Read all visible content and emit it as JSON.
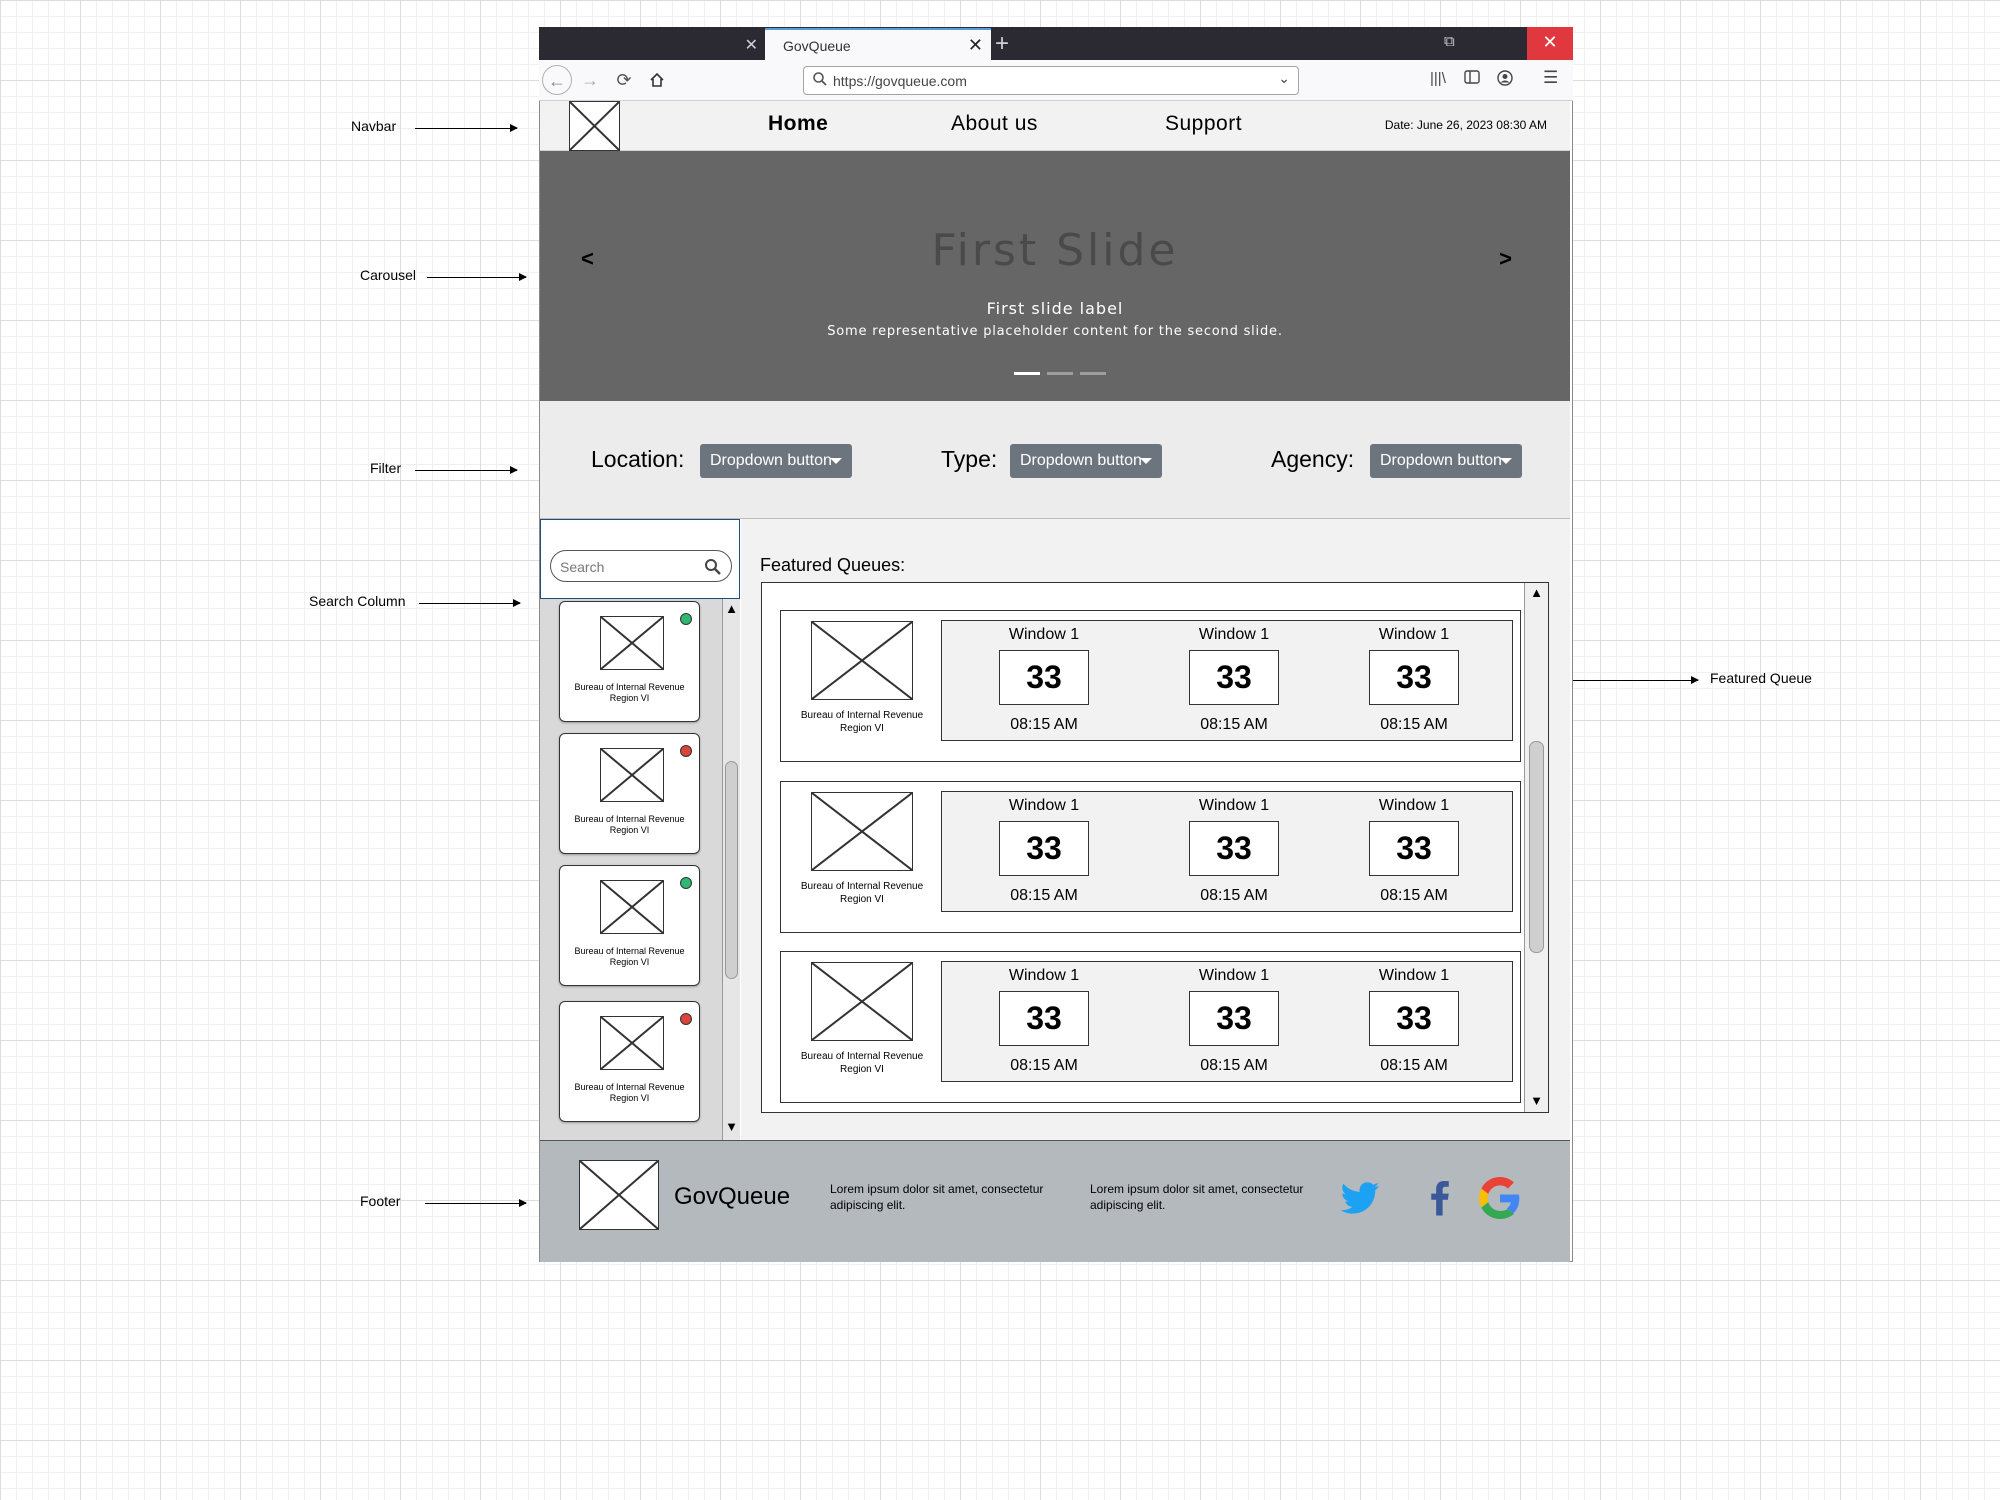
{
  "annotations": {
    "navbar": "Navbar",
    "carousel": "Carousel",
    "filter": "Filter",
    "search_column": "Search Column",
    "footer": "Footer",
    "featured_queue": "Featured Queue"
  },
  "browser": {
    "active_tab_title": "GovQueue",
    "url": "https://govqueue.com",
    "icons": [
      "back-icon",
      "forward-icon",
      "reload-icon",
      "home-icon",
      "library-icon",
      "sidebar-icon",
      "account-icon",
      "menu-icon"
    ]
  },
  "navbar": {
    "links": [
      "Home",
      "About us",
      "Support"
    ],
    "date": "Date: June 26, 2023 08:30 AM"
  },
  "carousel": {
    "title": "First Slide",
    "label": "First slide label",
    "caption": "Some representative placeholder content for the second slide.",
    "prev": "<",
    "next": ">",
    "indicator_count": 3,
    "active_indicator": 0
  },
  "filter": {
    "location_label": "Location:",
    "type_label": "Type:",
    "agency_label": "Agency:",
    "location_value": "Dropdown button",
    "type_value": "Dropdown button",
    "agency_value": "Dropdown button",
    "button_color": "#6c757d"
  },
  "search": {
    "placeholder": "Search",
    "agencies": [
      {
        "name": "Bureau of Internal Revenue Region VI",
        "status": "green"
      },
      {
        "name": "Bureau of Internal Revenue Region VI",
        "status": "red"
      },
      {
        "name": "Bureau of Internal Revenue Region VI",
        "status": "green"
      },
      {
        "name": "Bureau of Internal Revenue Region VI",
        "status": "red"
      }
    ],
    "status_colors": {
      "green": "#2eb872",
      "red": "#d9443b"
    }
  },
  "featured": {
    "title": "Featured Queues:",
    "queues": [
      {
        "agency": "Bureau of Internal Revenue Region VI",
        "windows": [
          {
            "label": "Window 1",
            "number": "33",
            "time": "08:15 AM"
          },
          {
            "label": "Window 1",
            "number": "33",
            "time": "08:15 AM"
          },
          {
            "label": "Window 1",
            "number": "33",
            "time": "08:15 AM"
          }
        ]
      },
      {
        "agency": "Bureau of Internal Revenue Region VI",
        "windows": [
          {
            "label": "Window 1",
            "number": "33",
            "time": "08:15 AM"
          },
          {
            "label": "Window 1",
            "number": "33",
            "time": "08:15 AM"
          },
          {
            "label": "Window 1",
            "number": "33",
            "time": "08:15 AM"
          }
        ]
      },
      {
        "agency": "Bureau of Internal Revenue Region VI",
        "windows": [
          {
            "label": "Window 1",
            "number": "33",
            "time": "08:15 AM"
          },
          {
            "label": "Window 1",
            "number": "33",
            "time": "08:15 AM"
          },
          {
            "label": "Window 1",
            "number": "33",
            "time": "08:15 AM"
          }
        ]
      }
    ]
  },
  "footer": {
    "brand": "GovQueue",
    "text_1": "Lorem ipsum dolor sit amet, consectetur adipiscing elit.",
    "text_2": "Lorem ipsum dolor sit amet, consectetur adipiscing elit.",
    "social": [
      "twitter-icon",
      "facebook-icon",
      "google-icon"
    ],
    "colors": {
      "twitter": "#1da1f2",
      "facebook": "#3b5998",
      "background": "#b3b9bd"
    }
  }
}
